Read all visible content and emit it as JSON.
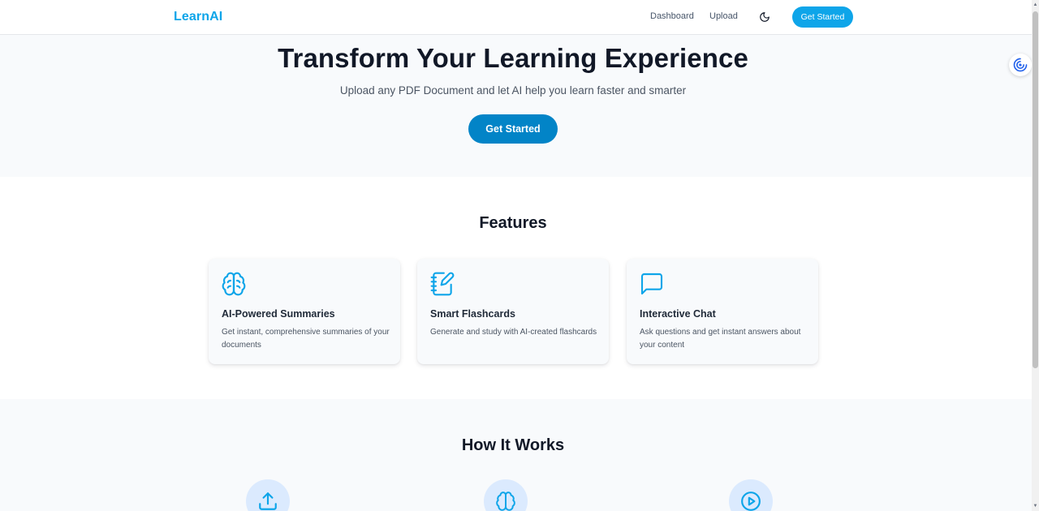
{
  "colors": {
    "brand": "#0ea5e9",
    "primary_button": "#0284c7",
    "icon": "#0ea5e9",
    "step_circle_bg": "#dbeafe"
  },
  "navbar": {
    "brand": "LearnAI",
    "links": [
      "Dashboard",
      "Upload"
    ],
    "theme_toggle_icon": "moon-icon",
    "cta_label": "Get Started"
  },
  "hero": {
    "title": "Transform Your Learning Experience",
    "subtitle": "Upload any PDF Document and let AI help you learn faster and smarter",
    "cta_label": "Get Started"
  },
  "features": {
    "title": "Features",
    "cards": [
      {
        "icon": "brain-icon",
        "title": "AI-Powered Summaries",
        "description": "Get instant, comprehensive summaries of your documents"
      },
      {
        "icon": "notebook-pen-icon",
        "title": "Smart Flashcards",
        "description": "Generate and study with AI-created flashcards"
      },
      {
        "icon": "chat-bubble-icon",
        "title": "Interactive Chat",
        "description": "Ask questions and get instant answers about your content"
      }
    ]
  },
  "how_it_works": {
    "title": "How It Works",
    "steps": [
      {
        "icon": "upload-icon"
      },
      {
        "icon": "brain-icon"
      },
      {
        "icon": "play-circle-icon"
      }
    ]
  },
  "floating_extension": {
    "icon": "swirl-logo-icon"
  }
}
